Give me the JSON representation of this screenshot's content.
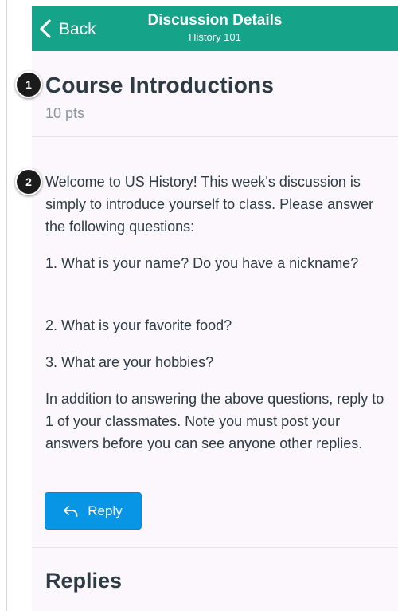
{
  "navbar": {
    "back_label": "Back",
    "title": "Discussion Details",
    "subtitle": "History 101",
    "background_color": "#15a38a"
  },
  "discussion": {
    "title": "Course Introductions",
    "points": "10 pts",
    "paragraphs": [
      "Welcome to US History! This week's discussion is simply to introduce yourself to class. Please answer the following questions:",
      "1. What is your name? Do you have a nickname?",
      "2. What is your favorite food?",
      "3. What are your hobbies?",
      "In addition to answering the above questions, reply to 1 of your classmates. Note you must post your answers before you can see anyone other replies."
    ]
  },
  "reply_button": {
    "label": "Reply",
    "icon": "reply-icon",
    "color": "#0895e6"
  },
  "replies": {
    "heading": "Replies"
  },
  "annotations": {
    "badge_1": "1",
    "badge_2": "2"
  }
}
